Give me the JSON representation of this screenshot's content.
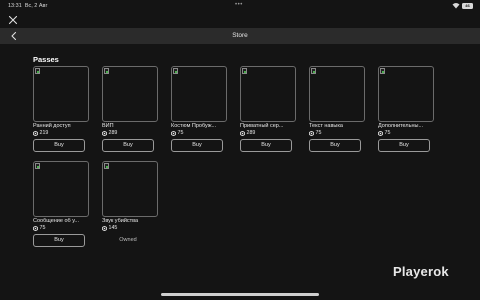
{
  "status_bar": {
    "time": "13:31",
    "date": "Вс, 2 Авг",
    "dots": "•••",
    "battery": "46"
  },
  "header": {
    "title": "Store"
  },
  "section": {
    "title": "Passes"
  },
  "cards": [
    {
      "name": "Ранний доступ",
      "price": "219",
      "action": "Buy",
      "owned": false
    },
    {
      "name": "ВИП",
      "price": "289",
      "action": "Buy",
      "owned": false
    },
    {
      "name": "Костюм Пробуж...",
      "price": "75",
      "action": "Buy",
      "owned": false
    },
    {
      "name": "Приватный сер...",
      "price": "289",
      "action": "Buy",
      "owned": false
    },
    {
      "name": "Текст навыка",
      "price": "75",
      "action": "Buy",
      "owned": false
    },
    {
      "name": "Дополнительны...",
      "price": "75",
      "action": "Buy",
      "owned": false
    },
    {
      "name": "Сообщение об у...",
      "price": "75",
      "action": "Buy",
      "owned": false
    },
    {
      "name": "Звук убийства",
      "price": "145",
      "action": "Owned",
      "owned": true
    }
  ],
  "watermark": "Playerok",
  "colors": {
    "background": "#141414",
    "header_bar": "#2b2b2b",
    "button_border": "#9a9a9a"
  },
  "icons": {
    "close": "close-icon",
    "back": "chevron-left-icon",
    "currency": "robux-icon",
    "broken_image": "broken-image-icon"
  }
}
